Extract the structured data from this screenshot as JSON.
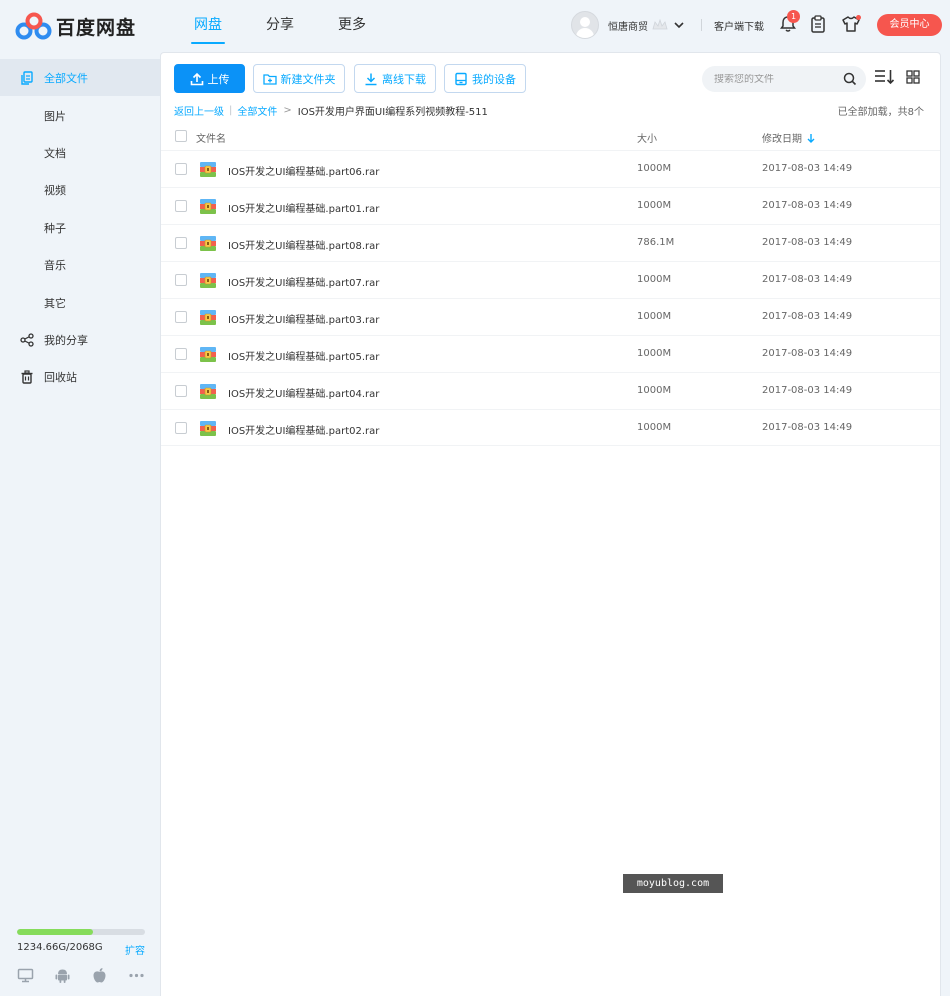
{
  "app": {
    "logo_text": "百度网盘",
    "nav": [
      "网盘",
      "分享",
      "更多"
    ],
    "active_nav": 0
  },
  "user": {
    "name": "恒唐商贸",
    "client_download": "客户端下载",
    "notification_count": "1",
    "vip_button": "会员中心"
  },
  "sidebar": {
    "items": [
      {
        "label": "全部文件",
        "icon": "files-icon",
        "active": true
      },
      {
        "label": "图片"
      },
      {
        "label": "文档"
      },
      {
        "label": "视频"
      },
      {
        "label": "种子"
      },
      {
        "label": "音乐"
      },
      {
        "label": "其它"
      },
      {
        "label": "我的分享",
        "icon": "share-icon"
      },
      {
        "label": "回收站",
        "icon": "trash-icon"
      }
    ],
    "quota_text": "1234.66G/2068G",
    "quota_used": 1234.66,
    "quota_total": 2068,
    "expand_label": "扩容",
    "platform_icons": [
      "desktop-icon",
      "android-icon",
      "apple-icon",
      "more-icon"
    ]
  },
  "toolbar": {
    "upload": "上传",
    "new_folder": "新建文件夹",
    "offline_download": "离线下载",
    "my_devices": "我的设备",
    "search_placeholder": "搜索您的文件"
  },
  "breadcrumb": {
    "back": "返回上一级",
    "all_files": "全部文件",
    "current": "IOS开发用户界面UI编程系列视频教程-511",
    "loaded_info": "已全部加载，共8个"
  },
  "table": {
    "columns": {
      "name": "文件名",
      "size": "大小",
      "date": "修改日期"
    },
    "rows": [
      {
        "name": "IOS开发之UI编程基础.part06.rar",
        "size": "1000M",
        "date": "2017-08-03 14:49"
      },
      {
        "name": "IOS开发之UI编程基础.part01.rar",
        "size": "1000M",
        "date": "2017-08-03 14:49"
      },
      {
        "name": "IOS开发之UI编程基础.part08.rar",
        "size": "786.1M",
        "date": "2017-08-03 14:49"
      },
      {
        "name": "IOS开发之UI编程基础.part07.rar",
        "size": "1000M",
        "date": "2017-08-03 14:49"
      },
      {
        "name": "IOS开发之UI编程基础.part03.rar",
        "size": "1000M",
        "date": "2017-08-03 14:49"
      },
      {
        "name": "IOS开发之UI编程基础.part05.rar",
        "size": "1000M",
        "date": "2017-08-03 14:49"
      },
      {
        "name": "IOS开发之UI编程基础.part04.rar",
        "size": "1000M",
        "date": "2017-08-03 14:49"
      },
      {
        "name": "IOS开发之UI编程基础.part02.rar",
        "size": "1000M",
        "date": "2017-08-03 14:49"
      }
    ]
  },
  "watermark": "moyublog.com",
  "colors": {
    "accent": "#09aaff",
    "primary_button": "#0b92f7",
    "vip": "#f6564e",
    "quota_fill": "#86dc5b"
  }
}
